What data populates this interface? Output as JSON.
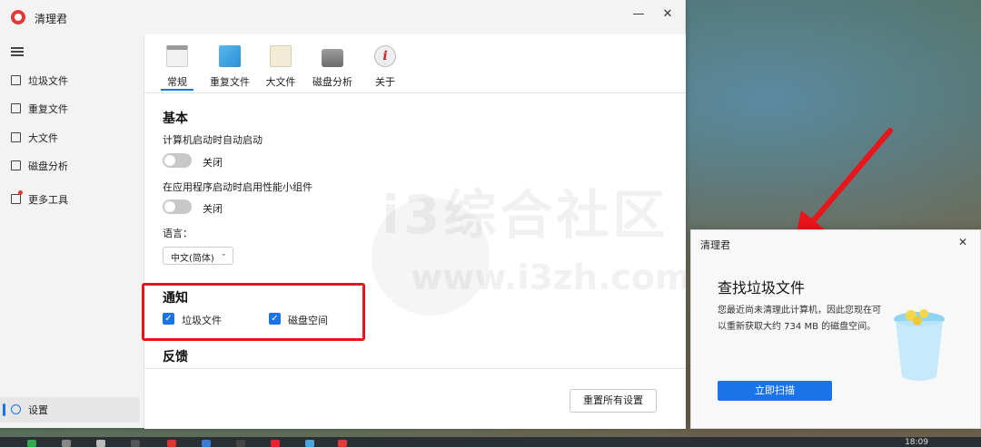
{
  "app": {
    "title": "清理君",
    "minimize": "—",
    "close": "✕"
  },
  "sidebar": {
    "items": [
      {
        "label": "垃圾文件",
        "icon": "trash-icon"
      },
      {
        "label": "重复文件",
        "icon": "duplicate-icon"
      },
      {
        "label": "大文件",
        "icon": "document-icon"
      },
      {
        "label": "磁盘分析",
        "icon": "disk-icon"
      },
      {
        "label": "更多工具",
        "icon": "tools-icon"
      }
    ],
    "settings": {
      "label": "设置",
      "icon": "gear-icon"
    }
  },
  "tabs": [
    {
      "label": "常规",
      "active": true
    },
    {
      "label": "重复文件",
      "active": false
    },
    {
      "label": "大文件",
      "active": false
    },
    {
      "label": "磁盘分析",
      "active": false
    },
    {
      "label": "关于",
      "active": false
    }
  ],
  "settings": {
    "basic_title": "基本",
    "autostart_label": "计算机启动时自动启动",
    "autostart_state": "关闭",
    "widget_label": "在应用程序启动时启用性能小组件",
    "widget_state": "关闭",
    "language_label": "语言：",
    "language_value": "中文(简体)",
    "notify_title": "通知",
    "notify_junk": "垃圾文件",
    "notify_disk": "磁盘空间",
    "feedback_title": "反馈",
    "reset_button": "重置所有设置"
  },
  "watermark": {
    "line1": "i3综合社区",
    "line2": "www.i3zh.com"
  },
  "notification": {
    "app": "清理君",
    "close": "✕",
    "heading": "查找垃圾文件",
    "body": "您最近尚未清理此计算机，因此您现在可以重新获取大约 734 MB 的磁盘空间。",
    "button": "立即扫描"
  },
  "taskbar": {
    "clock": "18:09"
  },
  "colors": {
    "accent": "#1a73e8",
    "annotation": "#e8151b",
    "brand": "#e4393c"
  }
}
